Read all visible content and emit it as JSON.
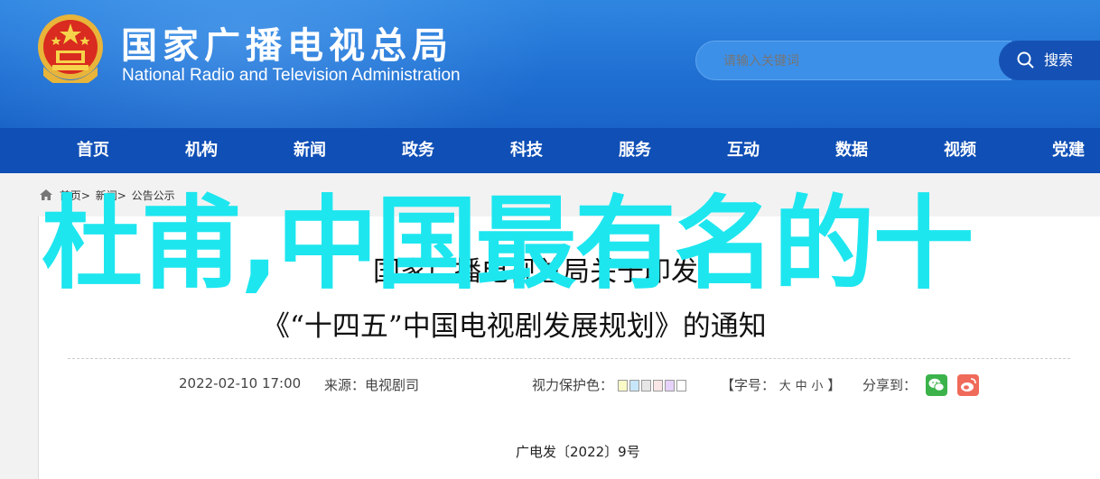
{
  "header": {
    "title_cn": "国家广播电视总局",
    "title_en": "National Radio and Television Administration",
    "search_placeholder": "请输入关键词",
    "search_button": "搜索"
  },
  "nav": [
    "首页",
    "机构",
    "新闻",
    "政务",
    "科技",
    "服务",
    "互动",
    "数据",
    "视频",
    "党建"
  ],
  "breadcrumb": {
    "home": "首页>",
    "news": "新闻>",
    "notice": "公告公示"
  },
  "overlay_text": "杜甫,中国最有名的十",
  "article": {
    "title_line1": "国家广播电视总局关于印发",
    "title_line2": "《“十四五”中国电视剧发展规划》的通知",
    "date": "2022-02-10 17:00",
    "source": "来源：电视剧司",
    "vision_label": "视力保护色：",
    "swatches": [
      "#fafac8",
      "#c8e6fa",
      "#e6e6e6",
      "#fae6e6",
      "#e6d2fa",
      "#ffffff"
    ],
    "font_label": "【字号：",
    "font_large": "大",
    "font_mid": "中",
    "font_small": "小",
    "font_close": "】",
    "share_label": "分享到：",
    "doc_number": "广电发〔2022〕9号"
  }
}
